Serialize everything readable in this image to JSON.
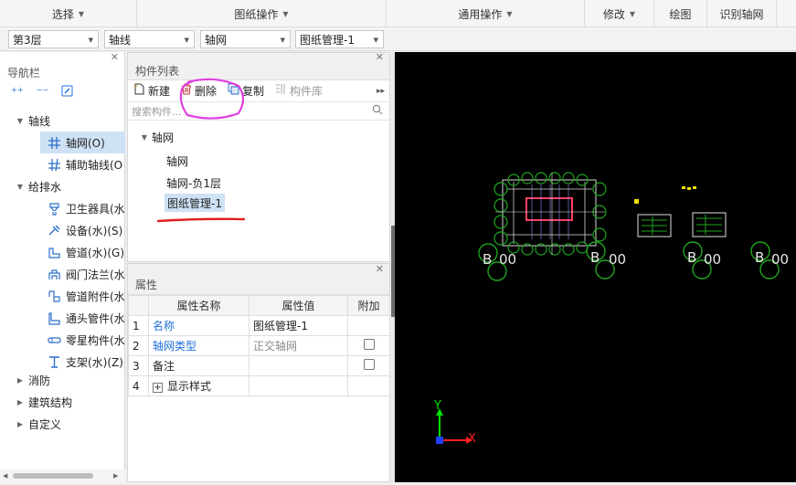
{
  "ribbon": {
    "groups": [
      {
        "label": "选择",
        "has_arrow": true
      },
      {
        "label": "图纸操作",
        "has_arrow": true
      },
      {
        "label": "通用操作",
        "has_arrow": true
      },
      {
        "label": "修改",
        "has_arrow": true
      },
      {
        "label": "绘图",
        "has_arrow": false
      },
      {
        "label": "识别轴网",
        "has_arrow": false
      }
    ]
  },
  "filters": {
    "floor": "第3层",
    "category": "轴线",
    "type": "轴网",
    "drawing": "图纸管理-1"
  },
  "nav": {
    "title": "导航栏",
    "tree": [
      {
        "label": "轴线",
        "kind": "group",
        "expanded": true
      },
      {
        "label": "轴网(O)",
        "kind": "item",
        "icon": "grid-icon",
        "selected": true
      },
      {
        "label": "辅助轴线(O",
        "kind": "item",
        "icon": "aux-axis-icon"
      },
      {
        "label": "给排水",
        "kind": "group",
        "expanded": true
      },
      {
        "label": "卫生器具(水",
        "kind": "item",
        "icon": "sanitary-icon"
      },
      {
        "label": "设备(水)(S)",
        "kind": "item",
        "icon": "equipment-icon"
      },
      {
        "label": "管道(水)(G)",
        "kind": "item",
        "icon": "pipe-icon"
      },
      {
        "label": "阀门法兰(水",
        "kind": "item",
        "icon": "valve-icon"
      },
      {
        "label": "管道附件(水",
        "kind": "item",
        "icon": "pipe-fitting-icon"
      },
      {
        "label": "通头管件(水",
        "kind": "item",
        "icon": "tee-icon"
      },
      {
        "label": "零星构件(水",
        "kind": "item",
        "icon": "misc-part-icon"
      },
      {
        "label": "支架(水)(Z)",
        "kind": "item",
        "icon": "bracket-icon"
      },
      {
        "label": "消防",
        "kind": "group",
        "expanded": false
      },
      {
        "label": "建筑结构",
        "kind": "group",
        "expanded": false
      },
      {
        "label": "自定义",
        "kind": "group",
        "expanded": false
      }
    ]
  },
  "components": {
    "title": "构件列表",
    "toolbar": {
      "new": "新建",
      "delete": "删除",
      "copy": "复制",
      "library": "构件库"
    },
    "search_placeholder": "搜索构件...",
    "tree_root": "轴网",
    "items": [
      "轴网",
      "轴网-负1层",
      "图纸管理-1"
    ],
    "selected": "图纸管理-1"
  },
  "properties": {
    "title": "属性",
    "headers": [
      "属性名称",
      "属性值",
      "附加"
    ],
    "rows": [
      {
        "num": "1",
        "name": "名称",
        "value": "图纸管理-1",
        "has_checkbox": false
      },
      {
        "num": "2",
        "name": "轴网类型",
        "value": "正交轴网",
        "has_checkbox": true
      },
      {
        "num": "3",
        "name": "备注",
        "value": "",
        "has_checkbox": true
      },
      {
        "num": "4",
        "name": "显示样式",
        "value": "",
        "has_checkbox": false
      }
    ]
  },
  "canvas": {
    "axis_y": "Y",
    "axis_x": "X",
    "colors": {
      "background": "#000000",
      "axis_y": "#00e000",
      "axis_x": "#ff2020",
      "annotation": "#e040e0"
    }
  }
}
